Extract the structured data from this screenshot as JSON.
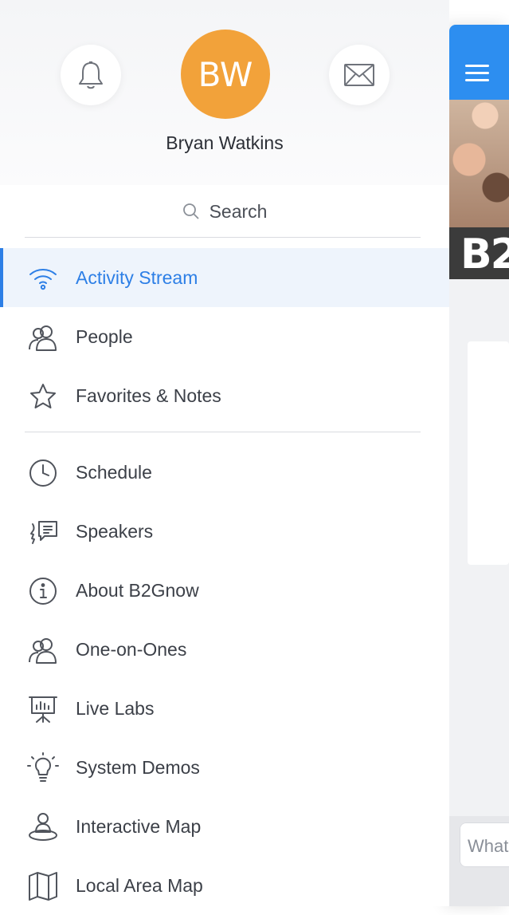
{
  "user": {
    "initials": "BW",
    "name": "Bryan Watkins",
    "avatar_color": "#f2a23a"
  },
  "header_buttons": {
    "left_icon": "bell-icon",
    "right_icon": "mail-icon"
  },
  "search": {
    "label": "Search",
    "icon": "search-icon"
  },
  "menu": {
    "primary": [
      {
        "label": "Activity Stream",
        "icon": "wifi-icon",
        "active": true
      },
      {
        "label": "People",
        "icon": "people-icon",
        "active": false
      },
      {
        "label": "Favorites & Notes",
        "icon": "star-icon",
        "active": false
      }
    ],
    "secondary": [
      {
        "label": "Schedule",
        "icon": "clock-icon"
      },
      {
        "label": "Speakers",
        "icon": "speaker-icon"
      },
      {
        "label": "About B2Gnow",
        "icon": "info-icon"
      },
      {
        "label": "One-on-Ones",
        "icon": "people-icon"
      },
      {
        "label": "Live Labs",
        "icon": "presentation-icon"
      },
      {
        "label": "System Demos",
        "icon": "lightbulb-icon"
      },
      {
        "label": "Interactive Map",
        "icon": "map-pin-icon"
      },
      {
        "label": "Local Area Map",
        "icon": "map-icon"
      }
    ]
  },
  "background_app": {
    "banner_text": "B2",
    "input_placeholder": "What"
  },
  "colors": {
    "accent": "#2d7fe6",
    "topbar": "#2d8ef0",
    "active_bg": "#eef4fc"
  }
}
